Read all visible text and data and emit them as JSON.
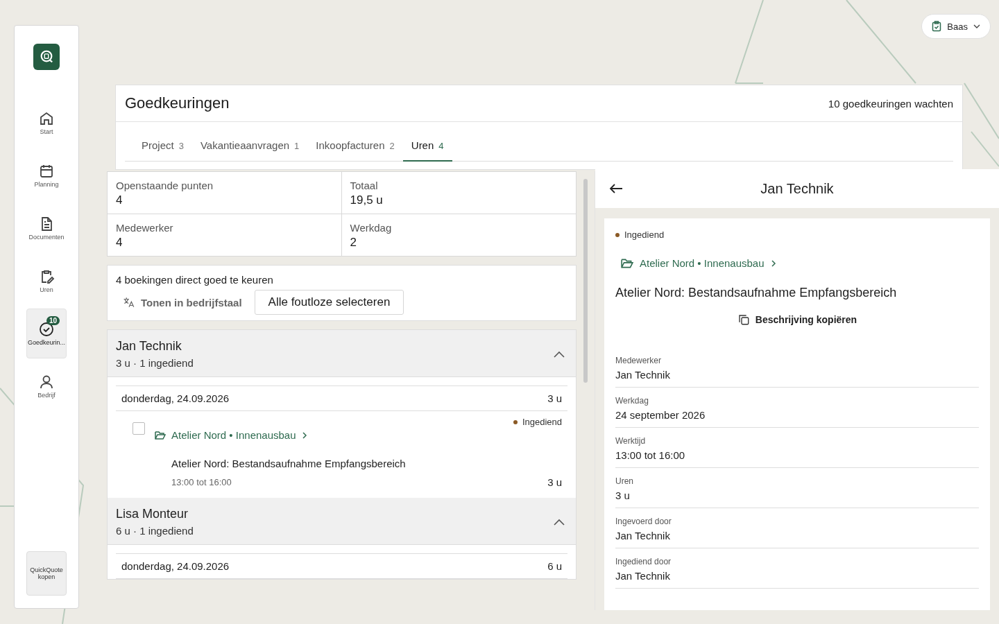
{
  "sidebar": {
    "items": [
      {
        "label": "Start",
        "selected": false
      },
      {
        "label": "Planning",
        "selected": false
      },
      {
        "label": "Documenten",
        "selected": false
      },
      {
        "label": "Uren",
        "selected": false
      },
      {
        "label": "Goedkeurin...",
        "selected": true,
        "badge": "10"
      },
      {
        "label": "Bedrijf",
        "selected": false
      }
    ],
    "buy_button": "QuickQuote kopen"
  },
  "role_menu": {
    "label": "Baas"
  },
  "panel": {
    "title": "Goedkeuringen",
    "summary": "10 goedkeuringen wachten",
    "tabs": [
      {
        "label": "Project",
        "count": "3",
        "selected": false
      },
      {
        "label": "Vakantieaanvragen",
        "count": "1",
        "selected": false
      },
      {
        "label": "Inkoopfacturen",
        "count": "2",
        "selected": false
      },
      {
        "label": "Uren",
        "count": "4",
        "selected": true
      }
    ]
  },
  "stats": [
    {
      "label": "Openstaande punten",
      "value": "4"
    },
    {
      "label": "Totaal",
      "value": "19,5 u"
    },
    {
      "label": "Medewerker",
      "value": "4"
    },
    {
      "label": "Werkdag",
      "value": "2"
    }
  ],
  "bulk": {
    "text": "4 boekingen direct goed te keuren",
    "translate": "Tonen in bedrijfstaal",
    "select_all": "Alle foutloze selecteren"
  },
  "groups": [
    {
      "name": "Jan Technik",
      "summary": "3 u · 1 ingediend",
      "expanded": true,
      "days": [
        {
          "date": "donderdag, 24.09.2026",
          "total": "3 u",
          "entries": [
            {
              "checked": false,
              "status": "Ingediend",
              "color": "#8b5a26",
              "project": "Atelier Nord • Innenausbau",
              "description": "Atelier Nord: Bestandsaufnahme Empfangsbereich",
              "time": "13:00 tot 16:00",
              "hours": "3 u"
            }
          ]
        }
      ]
    },
    {
      "name": "Lisa Monteur",
      "summary": "6 u · 1 ingediend",
      "expanded": true,
      "days": [
        {
          "date": "donderdag, 24.09.2026",
          "total": "6 u"
        }
      ]
    }
  ],
  "detail": {
    "title": "Jan Technik",
    "status": "Ingediend",
    "color": "#8b5a26",
    "project": "Atelier Nord • Innenausbau",
    "description": "Atelier Nord: Bestandsaufnahme Empfangsbereich",
    "copy_button": "Beschrijving kopiëren",
    "fields": [
      {
        "label": "Medewerker",
        "value": "Jan Technik"
      },
      {
        "label": "Werkdag",
        "value": "24 september 2026"
      },
      {
        "label": "Werktijd",
        "value": "13:00 tot 16:00"
      },
      {
        "label": "Uren",
        "value": "3 u"
      },
      {
        "label": "Ingevoerd door",
        "value": "Jan Technik"
      },
      {
        "label": "Ingediend door",
        "value": "Jan Technik"
      }
    ]
  }
}
